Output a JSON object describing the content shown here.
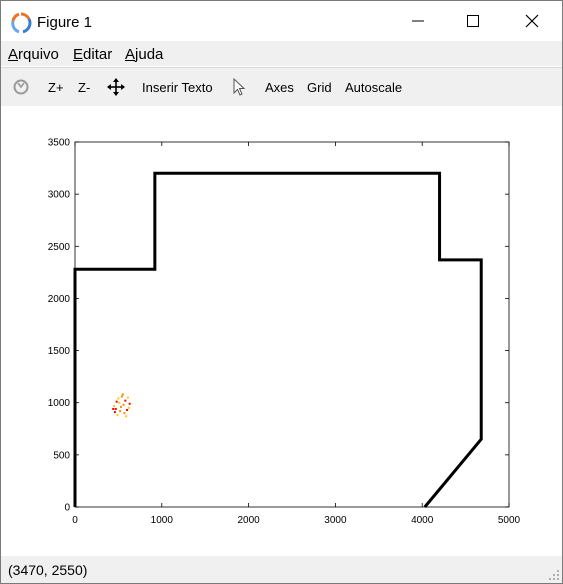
{
  "window": {
    "title": "Figure 1"
  },
  "menu": [
    {
      "label": "Arquivo"
    },
    {
      "label": "Editar"
    },
    {
      "label": "Ajuda"
    }
  ],
  "toolbar": {
    "rotate_icon": "rotate-icon",
    "zoom_in": "Z+",
    "zoom_out": "Z-",
    "pan_icon": "pan-icon",
    "insert_text": "Inserir Texto",
    "select_icon": "pointer-icon",
    "axes": "Axes",
    "grid": "Grid",
    "autoscale": "Autoscale"
  },
  "status": {
    "coords": "(3470, 2550)"
  },
  "chart_data": {
    "type": "line",
    "title": "",
    "xlabel": "",
    "ylabel": "",
    "xlim": [
      0,
      5000
    ],
    "ylim": [
      0,
      3500
    ],
    "x_ticks": [
      "0",
      "1000",
      "2000",
      "3000",
      "4000",
      "5000"
    ],
    "y_ticks": [
      "0",
      "500",
      "1000",
      "1500",
      "2000",
      "2500",
      "3000",
      "3500"
    ],
    "grid": false,
    "series": [
      {
        "color": "#000000",
        "points": [
          [
            0,
            0
          ],
          [
            0,
            2280
          ],
          [
            920,
            2280
          ],
          [
            920,
            3200
          ],
          [
            4200,
            3200
          ],
          [
            4200,
            2370
          ],
          [
            4680,
            2370
          ],
          [
            4680,
            650
          ],
          [
            4030,
            0
          ]
        ]
      },
      {
        "type": "scatter",
        "colors": [
          "#ff0000",
          "#ffcc00",
          "#ff8800"
        ],
        "center": [
          540,
          960
        ],
        "points": [
          [
            470,
            940
          ],
          [
            510,
            1000
          ],
          [
            560,
            980
          ],
          [
            600,
            930
          ],
          [
            490,
            880
          ],
          [
            540,
            1060
          ],
          [
            580,
            1020
          ],
          [
            450,
            970
          ],
          [
            520,
            920
          ],
          [
            630,
            990
          ],
          [
            500,
            1040
          ],
          [
            570,
            900
          ],
          [
            460,
            910
          ],
          [
            610,
            1050
          ],
          [
            530,
            960
          ],
          [
            480,
            1010
          ],
          [
            590,
            870
          ],
          [
            550,
            1080
          ],
          [
            440,
            940
          ],
          [
            620,
            950
          ]
        ]
      }
    ]
  }
}
